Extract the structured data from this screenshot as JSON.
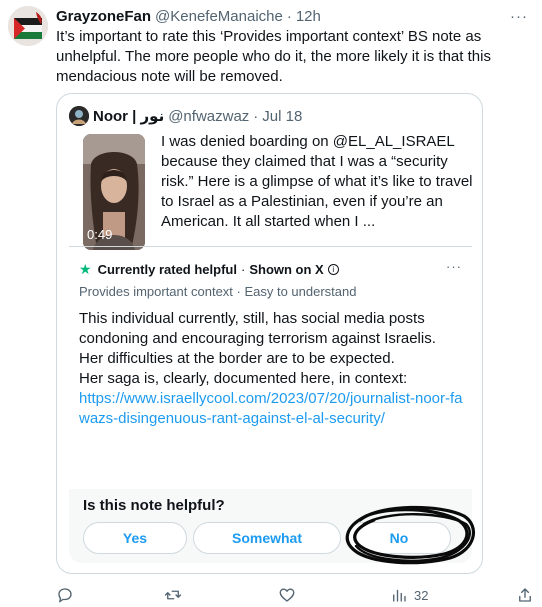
{
  "tweet": {
    "author_name": "GrayzoneFan",
    "author_handle": "@KenefeManaiche",
    "dot": "·",
    "time": "12h",
    "more": "···",
    "text": "It’s important to rate this ‘Provides important context’ BS note as unhelpful. The more people who do it, the more likely it is that this mendacious note will be removed."
  },
  "quote": {
    "author_name": "Noor | نور",
    "author_handle": "@nfwazwaz",
    "dot": "·",
    "time": "Jul 18",
    "video_duration": "0:49",
    "text": "I was denied boarding on @EL_AL_ISRAEL because they claimed that I was a “security risk.” Here is a glimpse of what it’s like to travel to Israel as a Palestinian, even if you’re an American. It all started when I ..."
  },
  "note": {
    "status": "Currently rated helpful",
    "sep": "·",
    "shown_on": "Shown on X",
    "info_icon": "ⓘ",
    "more": "···",
    "subtitle": "Provides important context · Easy to understand",
    "body_line1": "This individual currently, still, has social media posts condoning and encouraging terrorism against Israelis.",
    "body_line2": "Her difficulties at the border are to be expected.",
    "body_line3": "Her saga is, clearly, documented here, in context:",
    "link": "https://www.israellycool.com/2023/07/20/journalist-noor-fawazs-disingenuous-rant-against-el-al-security/"
  },
  "poll": {
    "question": "Is this note helpful?",
    "yes": "Yes",
    "somewhat": "Somewhat",
    "no": "No"
  },
  "actions": {
    "views_count": "32"
  },
  "colors": {
    "accent": "#1d9bf0",
    "helpful_green": "#00ba7c",
    "muted": "#536471"
  }
}
